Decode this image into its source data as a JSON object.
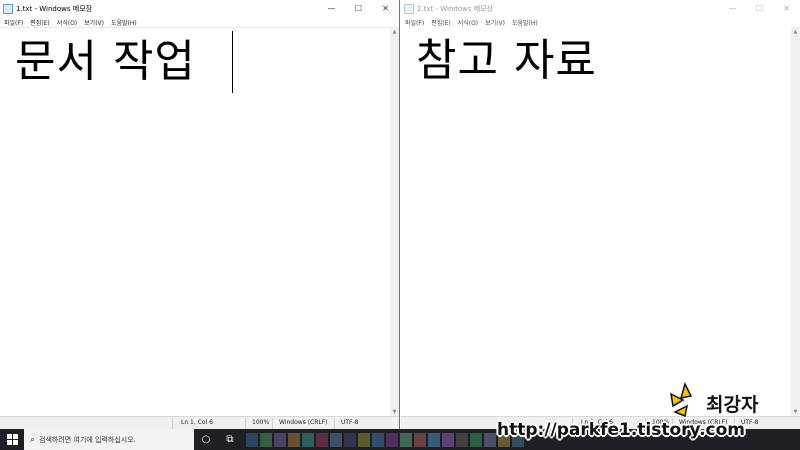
{
  "left_window": {
    "title": "1.txt - Windows 메모장",
    "menu": [
      "파일(F)",
      "편집(E)",
      "서식(O)",
      "보기(V)",
      "도움말(H)"
    ],
    "content": "문서 작업",
    "status": {
      "position": "Ln 1, Col 6",
      "zoom": "100%",
      "line_ending": "Windows (CRLF)",
      "encoding": "UTF-8"
    }
  },
  "right_window": {
    "title": "2.txt - Windows 메모장",
    "menu": [
      "파일(F)",
      "편집(E)",
      "서식(O)",
      "보기(V)",
      "도움말(H)"
    ],
    "content": "참고 자료",
    "status": {
      "position": "Ln 1, Col 6",
      "zoom": "100%",
      "line_ending": "Windows (CRLF)",
      "encoding": "UTF-8"
    }
  },
  "window_controls": {
    "minimize": "—",
    "maximize": "☐",
    "close": "✕"
  },
  "taskbar": {
    "search_placeholder": "검색하려면 여기에 입력하십시오.",
    "cortana_icon": "○",
    "taskview_icon": "⧉",
    "app_colors": [
      "#2f4f6f",
      "#3b6e4a",
      "#5c4a7a",
      "#7a5a2f",
      "#2f6f6a",
      "#6f2f4a",
      "#4a5c7a",
      "#3a3a5a",
      "#6a6a2f",
      "#2f5c7a",
      "#5a2f6f",
      "#4a7a5c",
      "#7a4a4a",
      "#3f6a8a",
      "#6a4a8a",
      "#4a4a4a",
      "#2f6f4f",
      "#5a5a7a",
      "#7a6a3a",
      "#3a5a6a"
    ]
  },
  "watermark": {
    "name": "최강자",
    "url": "http://parkfe1.tistory.com",
    "logo_color": "#f5c400"
  }
}
